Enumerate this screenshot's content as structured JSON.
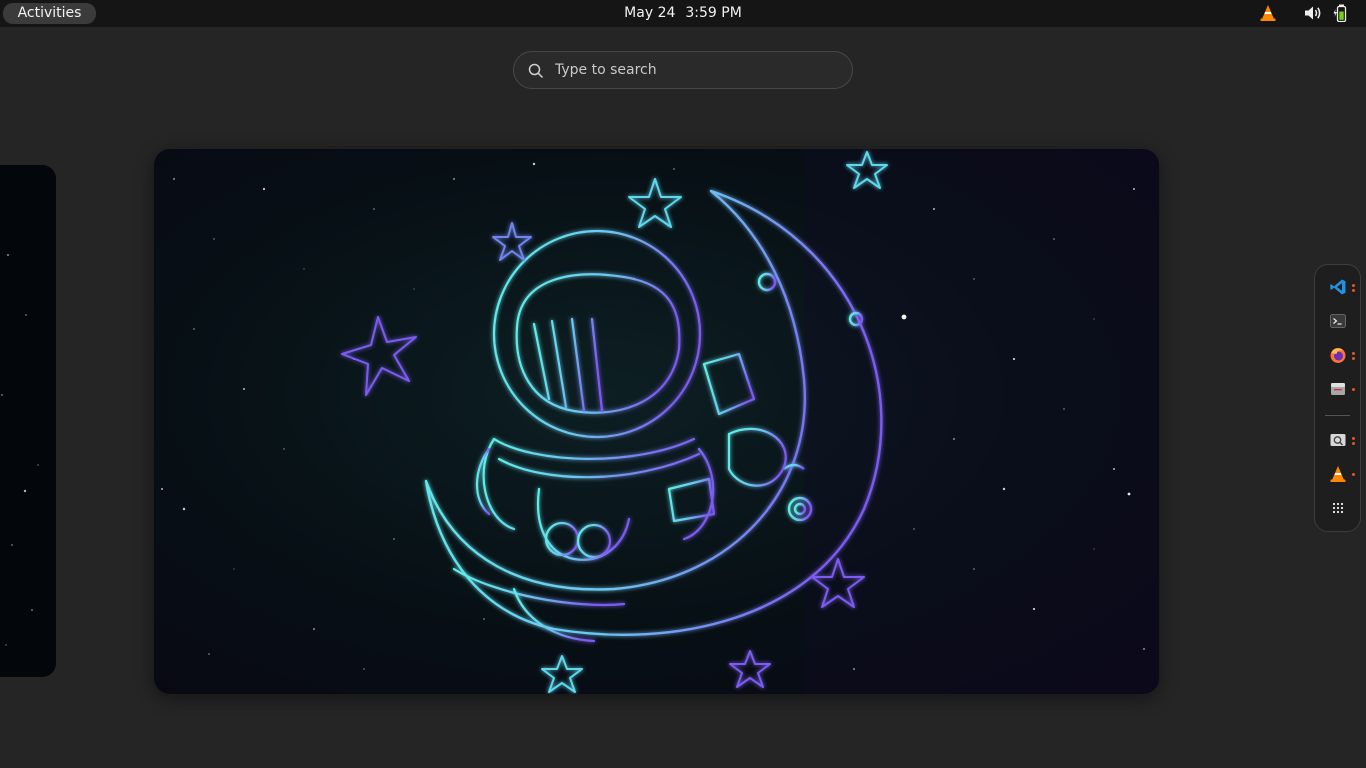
{
  "topbar": {
    "activities_label": "Activities",
    "date": "May 24",
    "time": "3:59 PM",
    "tray": [
      "vlc-icon",
      "volume-icon",
      "battery-icon"
    ]
  },
  "search": {
    "placeholder": "Type to search"
  },
  "workspaces": {
    "current_wallpaper": "astronaut-on-crescent-moon-neon-line-art"
  },
  "dash": {
    "apps": [
      {
        "name": "vscode-icon",
        "running_dots": 2
      },
      {
        "name": "terminal-icon",
        "running_dots": 0
      },
      {
        "name": "firefox-icon",
        "running_dots": 2
      },
      {
        "name": "files-icon",
        "running_dots": 1
      },
      {
        "name": "screenshot-viewer-icon",
        "running_dots": 2
      },
      {
        "name": "vlc-icon",
        "running_dots": 1
      },
      {
        "name": "show-apps-grid-icon",
        "running_dots": 0
      }
    ]
  },
  "colors": {
    "accent": "#e95420",
    "neon_cyan": "#5ef0e6",
    "neon_violet": "#7b5cf0",
    "panel": "#151515",
    "overview_bg": "#252525"
  }
}
